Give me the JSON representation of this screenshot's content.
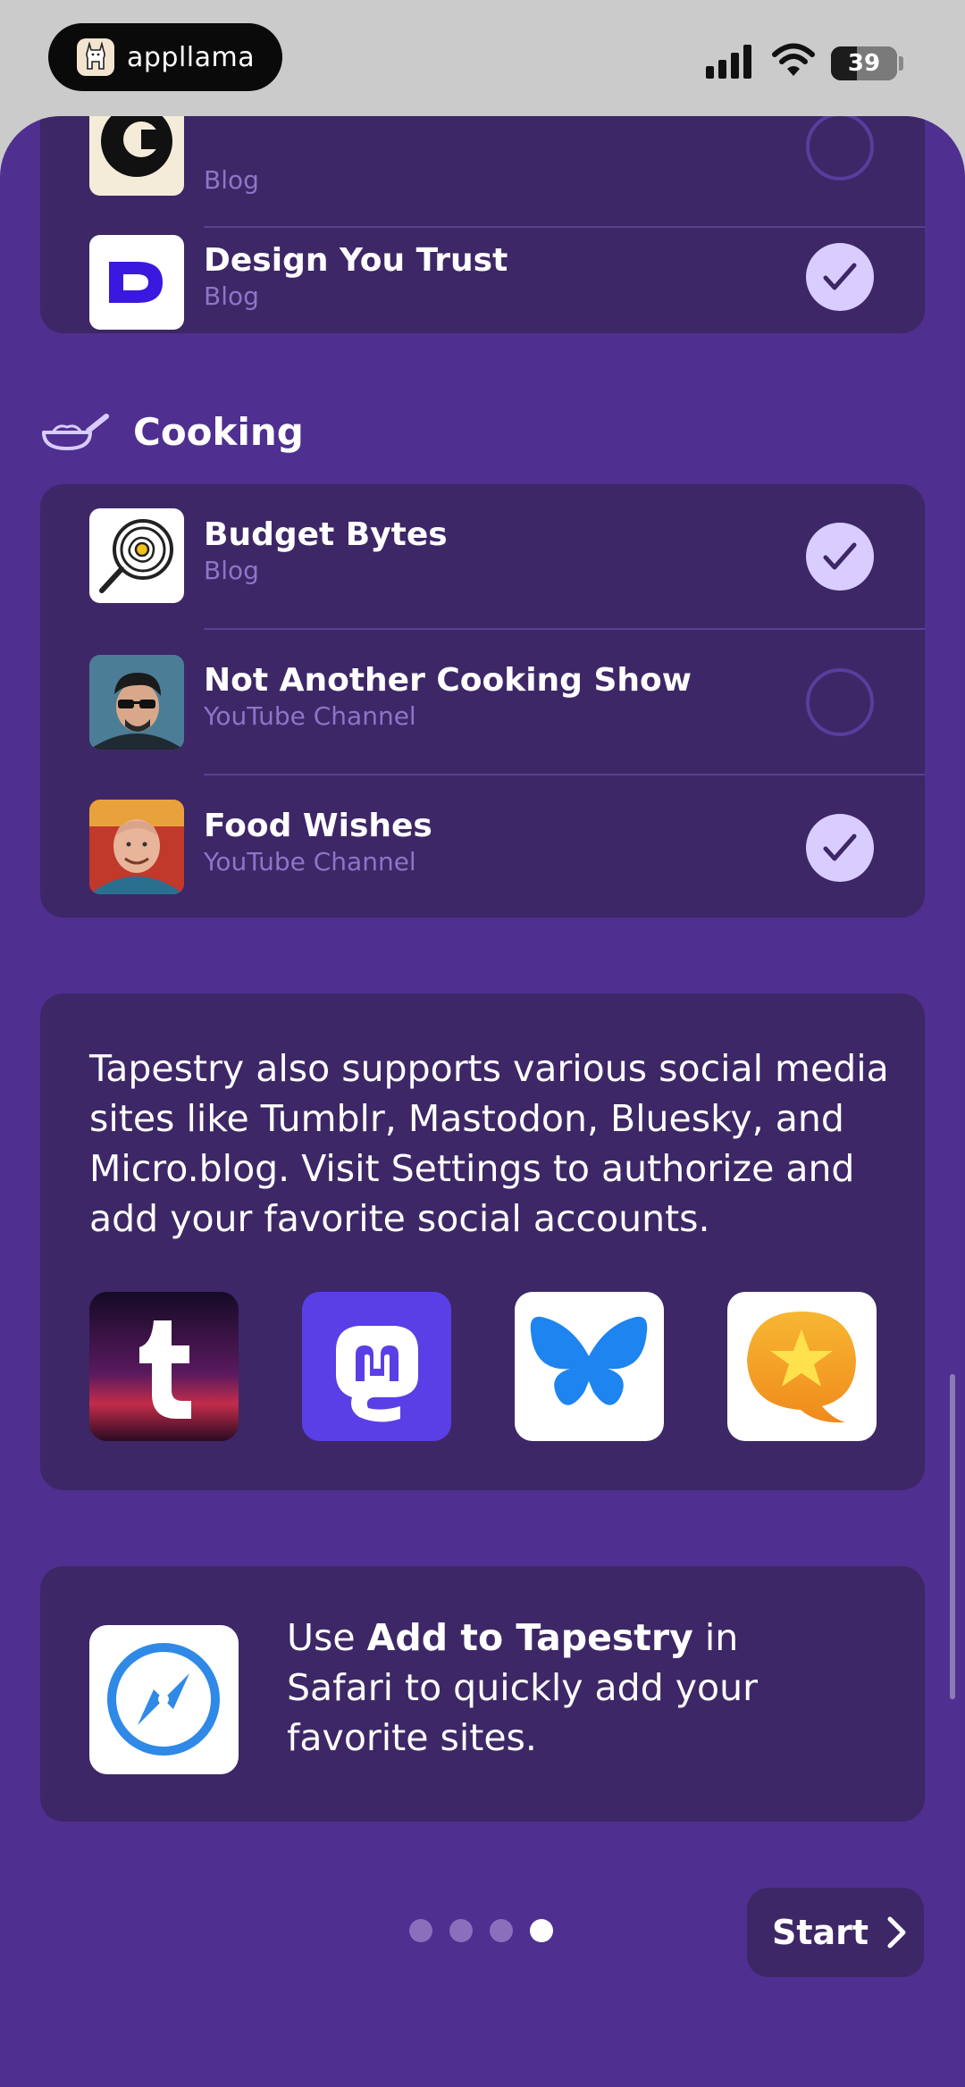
{
  "status_bar": {
    "app_pill_label": "appllama",
    "battery_level": "39",
    "battery_percent": 39
  },
  "top_card": {
    "partial_row_subtitle": "Blog",
    "rows": [
      {
        "title": "Design You Trust",
        "subtitle": "Blog",
        "checked": true
      }
    ]
  },
  "cooking": {
    "section_title": "Cooking",
    "rows": [
      {
        "title": "Budget Bytes",
        "subtitle": "Blog",
        "checked": true
      },
      {
        "title": "Not Another Cooking Show",
        "subtitle": "YouTube Channel",
        "checked": false
      },
      {
        "title": "Food Wishes",
        "subtitle": "YouTube Channel",
        "checked": true
      }
    ]
  },
  "social_card": {
    "text": "Tapestry also supports various social media sites like Tumblr, Mastodon, Bluesky, and Micro.blog. Visit Settings to authorize and add your favorite social accounts.",
    "icons": [
      "tumblr-icon",
      "mastodon-icon",
      "bluesky-icon",
      "microblog-icon"
    ]
  },
  "safari_card": {
    "text_prefix": "Use ",
    "text_bold": "Add to Tapestry",
    "text_suffix": " in Safari to quickly add your favorite sites."
  },
  "pager": {
    "total_pages": 4,
    "current_page": 4
  },
  "start_button": {
    "label": "Start"
  },
  "colors": {
    "background": "#4f2f8f",
    "card": "#3d2766",
    "check_fill": "#d9ccff",
    "subtitle": "#8f74c9"
  }
}
